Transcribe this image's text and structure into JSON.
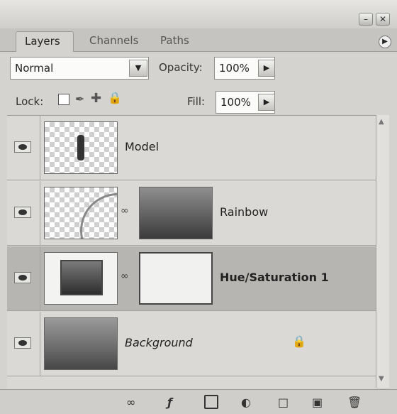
{
  "tabs": [
    "Layers",
    "Channels",
    "Paths"
  ],
  "blend_mode": "Normal",
  "opacity": {
    "label": "Opacity:",
    "value": "100%"
  },
  "lock_label": "Lock:",
  "fill": {
    "label": "Fill:",
    "value": "100%"
  },
  "layers": [
    {
      "name": "Model"
    },
    {
      "name": "Rainbow"
    },
    {
      "name": "Hue/Saturation 1"
    },
    {
      "name": "Background"
    }
  ],
  "icons": {
    "minimize": "minimize-icon",
    "close": "close-icon",
    "panel_menu": "panel-menu-icon",
    "dropdown": "chevron-down-icon",
    "arrow": "play-arrow-icon",
    "lock_transparent": "lock-transparent-icon",
    "lock_paint": "brush-icon",
    "lock_move": "move-icon",
    "lock_all": "lock-icon",
    "visibility": "eye-icon",
    "link": "chain-icon",
    "bottom": [
      "link-layers-icon",
      "fx-icon",
      "mask-icon",
      "adjustment-icon",
      "folder-icon",
      "new-layer-icon",
      "trash-icon"
    ]
  }
}
